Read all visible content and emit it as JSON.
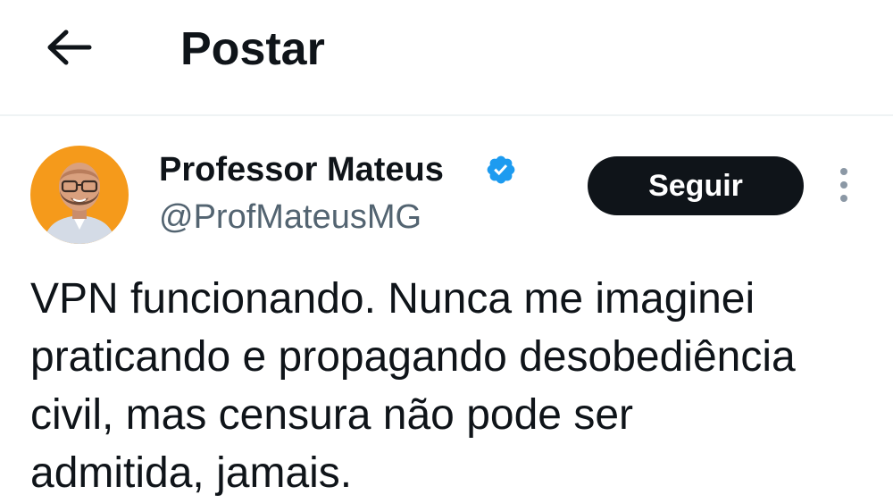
{
  "header": {
    "back_icon": "arrow-left-icon",
    "title": "Postar"
  },
  "author": {
    "name": "Professor Mateus",
    "handle": "@ProfMateusMG",
    "verified_icon": "verified-badge-icon",
    "avatar": "avatar-photo"
  },
  "actions": {
    "follow_label": "Seguir",
    "more_icon": "more-vertical-icon"
  },
  "post": {
    "text": "VPN funcionando. Nunca me imaginei\npraticando e propagando desobediência\ncivil, mas censura não pode ser\nadmitida, jamais."
  },
  "colors": {
    "text_primary": "#0f1419",
    "text_secondary": "#536471",
    "verified_blue": "#1d9bf0",
    "follow_bg": "#0f1419",
    "avatar_bg": "#f59a1b"
  }
}
